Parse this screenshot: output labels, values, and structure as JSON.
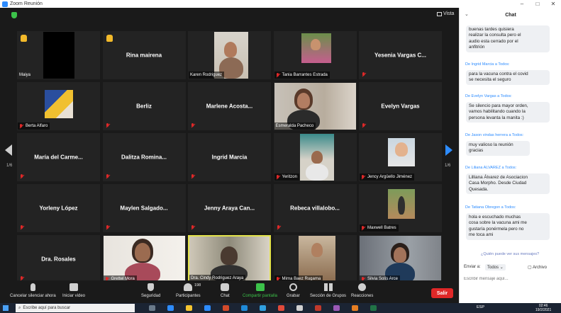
{
  "window": {
    "title": "Zoom Reunión",
    "minimize": "–",
    "maximize": "□",
    "close": "✕"
  },
  "meeting": {
    "view_label": "Vista",
    "page_left": "1/6",
    "page_right": "1/6",
    "tiles": [
      {
        "name": "Maiya",
        "hand": true,
        "display": ""
      },
      {
        "name": "",
        "hand": true,
        "display": "Rina mairena"
      },
      {
        "name": "Karen Rodriguez",
        "hand": false,
        "display": ""
      },
      {
        "name": "Tania Barrantes Estrada",
        "hand": false,
        "display": ""
      },
      {
        "name": "",
        "hand": false,
        "display": "Yesenia Vargas C..."
      },
      {
        "name": "Berta Alfaro",
        "hand": false,
        "display": ""
      },
      {
        "name": "",
        "hand": false,
        "display": "Berliz"
      },
      {
        "name": "",
        "hand": false,
        "display": "Marlene Acosta..."
      },
      {
        "name": "Esmeralda Pacheco",
        "hand": false,
        "display": ""
      },
      {
        "name": "",
        "hand": false,
        "display": "Evelyn Vargas"
      },
      {
        "name": "",
        "hand": false,
        "display": "María del Carme..."
      },
      {
        "name": "",
        "hand": false,
        "display": "Dalitza Romina..."
      },
      {
        "name": "",
        "hand": false,
        "display": "Ingrid Marcia"
      },
      {
        "name": "Yeritzon",
        "hand": false,
        "display": ""
      },
      {
        "name": "Jency Argüello Jiménez",
        "hand": false,
        "display": ""
      },
      {
        "name": "",
        "hand": false,
        "display": "Yorleny López"
      },
      {
        "name": "",
        "hand": false,
        "display": "Maylen Salgado..."
      },
      {
        "name": "",
        "hand": false,
        "display": "Jenny Araya Can..."
      },
      {
        "name": "",
        "hand": false,
        "display": "Rebeca villalobo..."
      },
      {
        "name": "Maxwell Batres",
        "hand": false,
        "display": ""
      },
      {
        "name": "",
        "hand": false,
        "display": "Dra. Rosales"
      },
      {
        "name": "Grettel Mora",
        "hand": false,
        "display": ""
      },
      {
        "name": "Dra. Cindy Rodriguez Araya",
        "hand": false,
        "display": "",
        "active": true
      },
      {
        "name": "Mirna Baez Rugama",
        "hand": false,
        "display": ""
      },
      {
        "name": "Silvia Solís Arce",
        "hand": false,
        "display": ""
      }
    ]
  },
  "toolbar": {
    "mute": "Cancelar silenciar ahora",
    "video": "Iniciar video",
    "security": "Seguridad",
    "participants": "Participantes",
    "participants_count": "198",
    "chat": "Chat",
    "share": "Compartir pantalla",
    "record": "Grabar",
    "rooms": "Sección de Grupos",
    "reactions": "Reacciones",
    "leave": "Salir"
  },
  "chat": {
    "title": "Chat",
    "messages": [
      {
        "sender": "",
        "lines": [
          "buenas tardes quisiera",
          "realizar la consulta pero el",
          "audio esta cerrado por el",
          "anfitrión"
        ]
      },
      {
        "sender": "De Ingrid Marcia a Todos:",
        "lines": [
          "para la vacuna contra el covid",
          "se necesita el seguro"
        ]
      },
      {
        "sender": "De Evelyn Vargas a Todos:",
        "lines": [
          "Se silencio para mayor orden,",
          "vamos habilitando cuando la",
          "persona levanta la manita :)"
        ]
      },
      {
        "sender": "De Jason vindas herrera a Todos:",
        "lines": [
          "muy valioso la reunión",
          "gracias"
        ]
      },
      {
        "sender": "De Liliana ALVAREZ a Todos:",
        "lines": [
          "Lilliana Álvarez de Asociacion",
          "Casa Morpho. Desde Ciudad",
          "Quesada."
        ]
      },
      {
        "sender": "De Tatiana Obregon a Todos:",
        "lines": [
          "hola e escuchado muchas",
          "cosa sobre la vacuna ami me",
          "gustaría ponérmela pero no",
          "me toca ami"
        ]
      }
    ],
    "hint": "¿Quién puede ver sus mensajes?",
    "send_to_label": "Enviar a:",
    "send_to_value": "Todos",
    "file_label": "Archivo",
    "input_placeholder": "Escribir mensaje aquí..."
  },
  "taskbar": {
    "search_placeholder": "Escribe aquí para buscar",
    "tray_text": "ESP",
    "time": "02:46",
    "date": "19/2/2021"
  },
  "colors": {
    "zoom_blue": "#2d8cff",
    "share_green": "#3cc24a",
    "leave_red": "#e02828",
    "active_speaker": "#e3e34b"
  }
}
